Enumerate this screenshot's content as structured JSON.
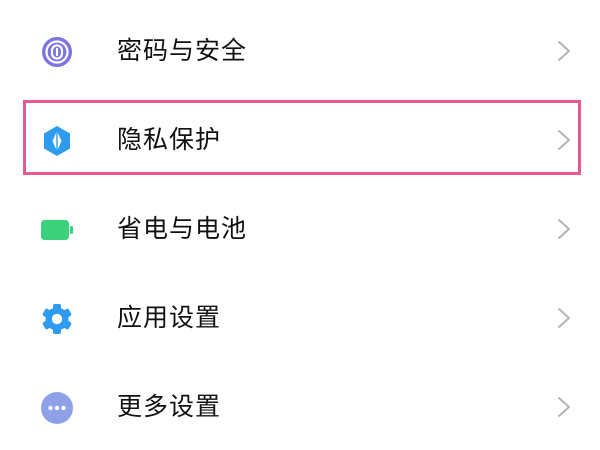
{
  "settings": {
    "items": [
      {
        "label": "密码与安全",
        "icon": "fingerprint-icon",
        "color": "#7b73e0"
      },
      {
        "label": "隐私保护",
        "icon": "privacy-shield-icon",
        "color": "#2d9bf0"
      },
      {
        "label": "省电与电池",
        "icon": "battery-icon",
        "color": "#3cd27c"
      },
      {
        "label": "应用设置",
        "icon": "gear-icon",
        "color": "#2d9bf0"
      },
      {
        "label": "更多设置",
        "icon": "more-dots-icon",
        "color": "#8ea1e8"
      }
    ],
    "highlighted_item": "隐私保护",
    "highlight_color": "#e8598f",
    "chevron_color": "#b5b5b5"
  }
}
